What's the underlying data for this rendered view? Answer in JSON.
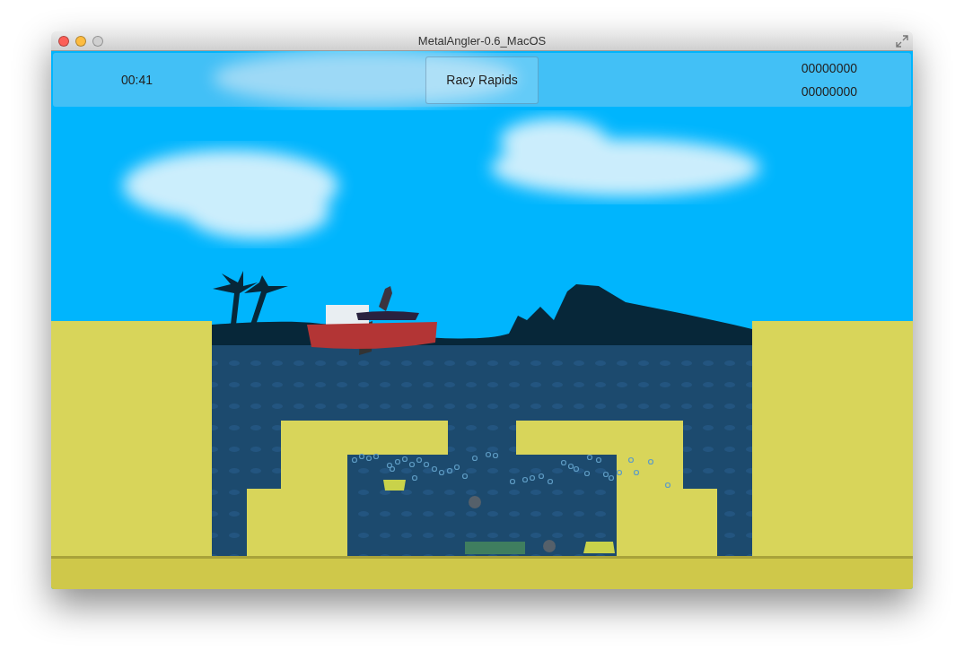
{
  "window": {
    "title": "MetalAngler-0.6_MacOS"
  },
  "hud": {
    "timer": "00:41",
    "level_button": "Racy Rapids",
    "scores": [
      "00000000",
      "00000000"
    ]
  }
}
